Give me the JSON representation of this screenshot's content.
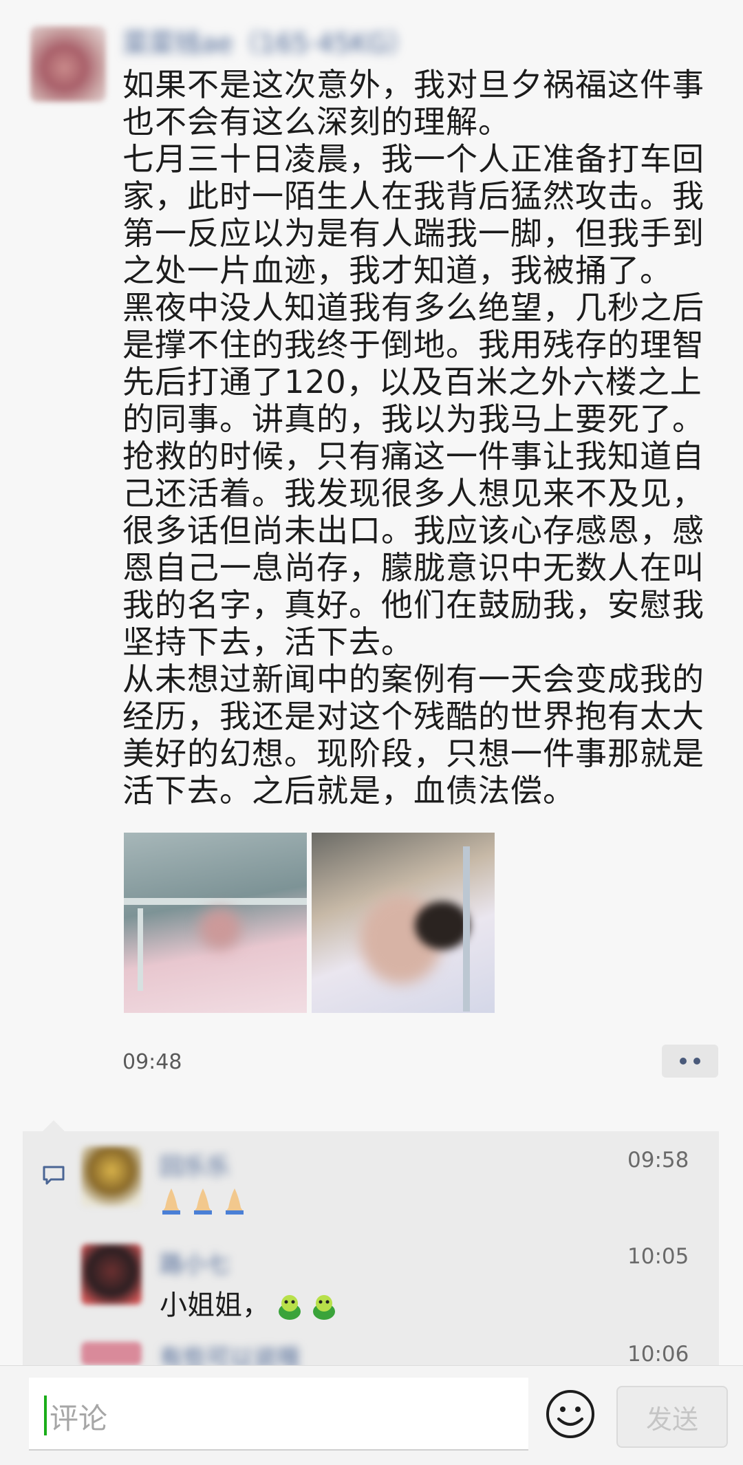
{
  "post": {
    "author_name": "菜菜钱ae（165·45KG）",
    "paragraphs": [
      "如果不是这次意外，我对旦夕祸福这件事也不会有这么深刻的理解。",
      "七月三十日凌晨，我一个人正准备打车回家，此时一陌生人在我背后猛然攻击。我第一反应以为是有人踹我一脚，但我手到之处一片血迹，我才知道，我被捅了。",
      "黑夜中没人知道我有多么绝望，几秒之后是撑不住的我终于倒地。我用残存的理智先后打通了120，以及百米之外六楼之上的同事。讲真的，我以为我马上要死了。",
      "抢救的时候，只有痛这一件事让我知道自己还活着。我发现很多人想见来不及见，很多话但尚未出口。我应该心存感恩，感恩自己一息尚存，朦胧意识中无数人在叫我的名字，真好。他们在鼓励我，安慰我坚持下去，活下去。",
      "从未想过新闻中的案例有一天会变成我的经历，我还是对这个残酷的世界抱有太大美好的幻想。现阶段，只想一件事那就是活下去。之后就是，血债法偿。"
    ],
    "time": "09:48"
  },
  "comments": [
    {
      "name": "回乐乐",
      "time": "09:58",
      "text": ""
    },
    {
      "name": "路小七",
      "time": "10:05",
      "text": "小姐姐，"
    },
    {
      "name": "有些可以说哦",
      "time": "10:06",
      "text": ""
    }
  ],
  "composer": {
    "placeholder": "评论",
    "send_label": "发送"
  },
  "colors": {
    "name_link": "#4a6594",
    "cursor": "#1aad19",
    "comment_bg": "#ebebeb"
  }
}
